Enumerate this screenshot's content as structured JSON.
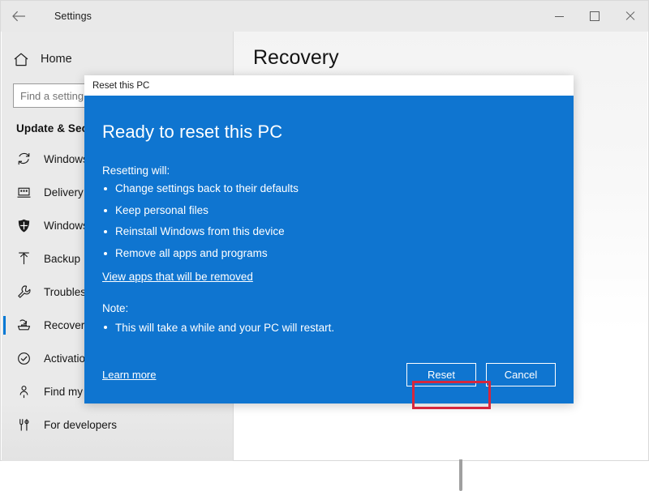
{
  "window": {
    "title": "Settings",
    "back_icon": "back-arrow-icon",
    "controls": {
      "minimize": "minimize-icon",
      "maximize": "maximize-icon",
      "close": "close-icon"
    }
  },
  "sidebar": {
    "home": {
      "label": "Home",
      "icon": "home-icon"
    },
    "search": {
      "value": "",
      "placeholder": "Find a setting"
    },
    "section_header": "Update & Secu",
    "items": [
      {
        "label": "Windows",
        "icon": "windows-update-icon",
        "selected": false
      },
      {
        "label": "Delivery O",
        "icon": "delivery-optimization-icon",
        "selected": false
      },
      {
        "label": "Windows",
        "icon": "shield-icon",
        "selected": false
      },
      {
        "label": "Backup",
        "icon": "backup-upload-icon",
        "selected": false
      },
      {
        "label": "Troublesh",
        "icon": "wrench-icon",
        "selected": false
      },
      {
        "label": "Recovery",
        "icon": "recovery-icon",
        "selected": true
      },
      {
        "label": "Activation",
        "icon": "check-circle-icon",
        "selected": false
      },
      {
        "label": "Find my device",
        "icon": "find-my-device-icon",
        "selected": false
      },
      {
        "label": "For developers",
        "icon": "developer-tools-icon",
        "selected": false
      }
    ]
  },
  "main": {
    "page_title": "Recovery"
  },
  "dialog": {
    "titlebar": "Reset this PC",
    "heading": "Ready to reset this PC",
    "subheading": "Resetting will:",
    "bullets": [
      "Change settings back to their defaults",
      "Keep personal files",
      "Reinstall Windows from this device",
      "Remove all apps and programs"
    ],
    "apps_link": "View apps that will be removed",
    "note_label": "Note:",
    "notes": [
      "This will take a while and your PC will restart."
    ],
    "learn_more": "Learn more",
    "buttons": {
      "primary": "Reset",
      "secondary": "Cancel"
    }
  },
  "colors": {
    "dialog_blue": "#0f75d0",
    "accent": "#0078d4",
    "highlight_red": "#d6273d",
    "sidebar_bg": "#eaeaea"
  }
}
